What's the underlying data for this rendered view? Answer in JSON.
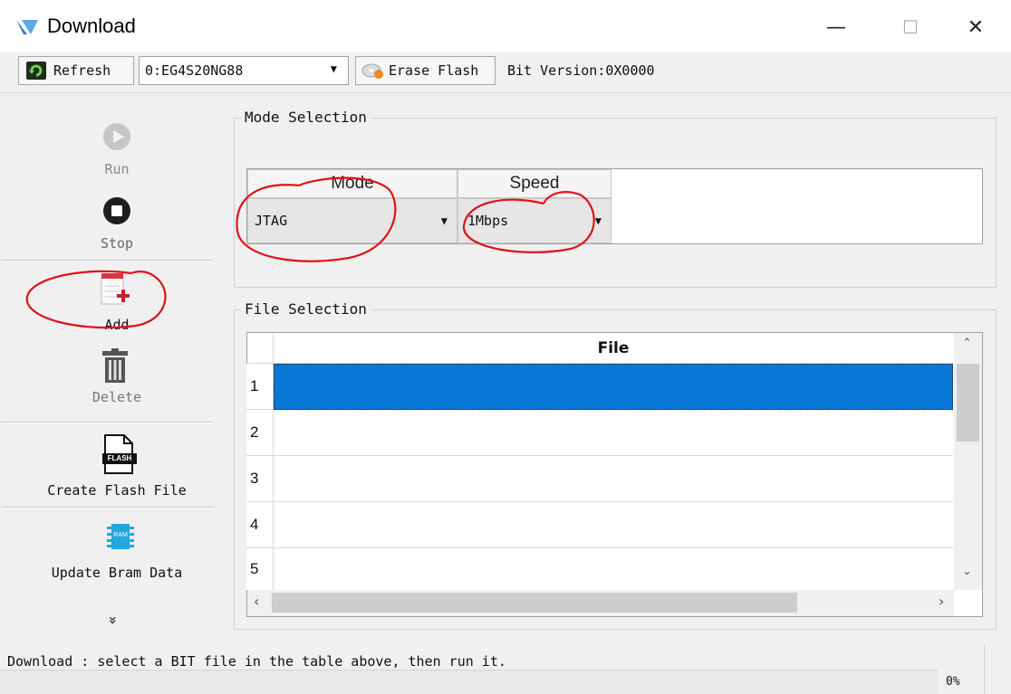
{
  "window": {
    "title": "Download",
    "minimize_glyph": "—",
    "maximize_glyph": "☐",
    "close_glyph": "✕",
    "logo_icon": "app-logo-icon"
  },
  "toolbar": {
    "refresh_label": "Refresh",
    "device_value": "0:EG4S20NG88",
    "erase_label": "Erase Flash",
    "bit_version": "Bit Version:0X0000"
  },
  "sidebar": {
    "run_label": "Run",
    "stop_label": "Stop",
    "add_label": "Add",
    "delete_label": "Delete",
    "create_flash_label": "Create Flash File",
    "flash_icon_text": "FLASH",
    "update_bram_label": "Update Bram Data",
    "ram_icon_text": "RAM",
    "more_glyph": "»"
  },
  "mode_selection": {
    "title": "Mode Selection",
    "mode_header": "Mode",
    "speed_header": "Speed",
    "mode_value": "JTAG",
    "speed_value": "1Mbps"
  },
  "file_selection": {
    "title": "File Selection",
    "column_header": "File",
    "rows": [
      "1",
      "2",
      "3",
      "4",
      "5"
    ],
    "selected_row": "1"
  },
  "status": {
    "message": "Download : select a BIT file in the table above, then run it.",
    "progress_text": "0%",
    "progress_value": 0
  },
  "colors": {
    "selection": "#0a78d7",
    "annotation": "#e0101a"
  }
}
